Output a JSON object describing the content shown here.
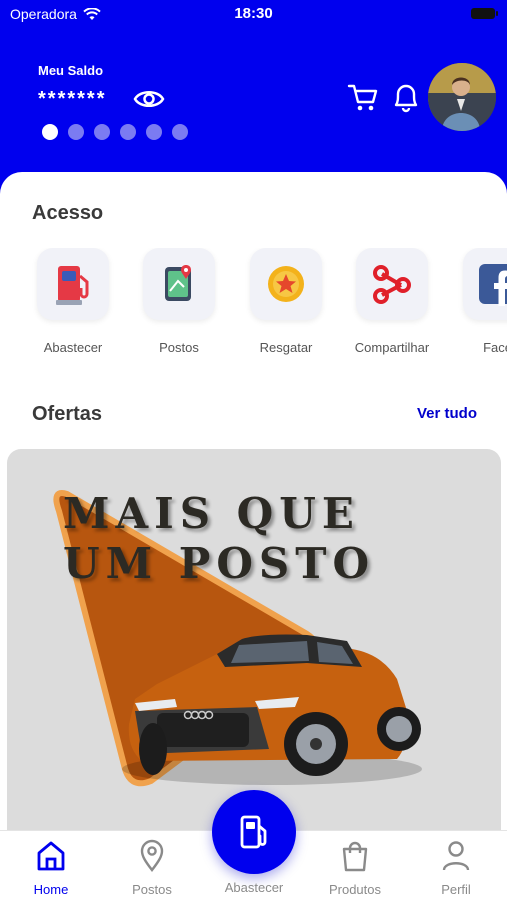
{
  "status_bar": {
    "carrier": "Operadora",
    "time": "18:30"
  },
  "header": {
    "balance_label": "Meu Saldo",
    "balance_value": "*******",
    "carousel": {
      "pages": 6,
      "active_index": 0
    },
    "icons": [
      "eye-icon",
      "cart-icon",
      "bell-icon"
    ]
  },
  "access": {
    "title": "Acesso",
    "items": [
      {
        "label": "Abastecer",
        "icon": "fuel-pump-icon"
      },
      {
        "label": "Postos",
        "icon": "map-pin-icon"
      },
      {
        "label": "Resgatar",
        "icon": "coin-star-icon"
      },
      {
        "label": "Compartilhar",
        "icon": "share-icon"
      },
      {
        "label": "Facel",
        "icon": "facebook-icon"
      }
    ]
  },
  "offers": {
    "title": "Ofertas",
    "see_all": "Ver tudo",
    "banner": {
      "line1": "MAIS QUE",
      "line2": "UM POSTO"
    }
  },
  "bottom_nav": {
    "items": [
      {
        "label": "Home",
        "icon": "home-icon",
        "active": true
      },
      {
        "label": "Postos",
        "icon": "map-pin-icon",
        "active": false
      },
      {
        "label": "Abastecer",
        "icon": "fuel-pump-icon",
        "active": false
      },
      {
        "label": "Produtos",
        "icon": "shopping-bag-icon",
        "active": false
      },
      {
        "label": "Perfil",
        "icon": "user-icon",
        "active": false
      }
    ]
  },
  "colors": {
    "primary": "#0000ee",
    "accent_orange": "#c25f12",
    "text_dark": "#3a3a3a",
    "link": "#0000cc"
  }
}
